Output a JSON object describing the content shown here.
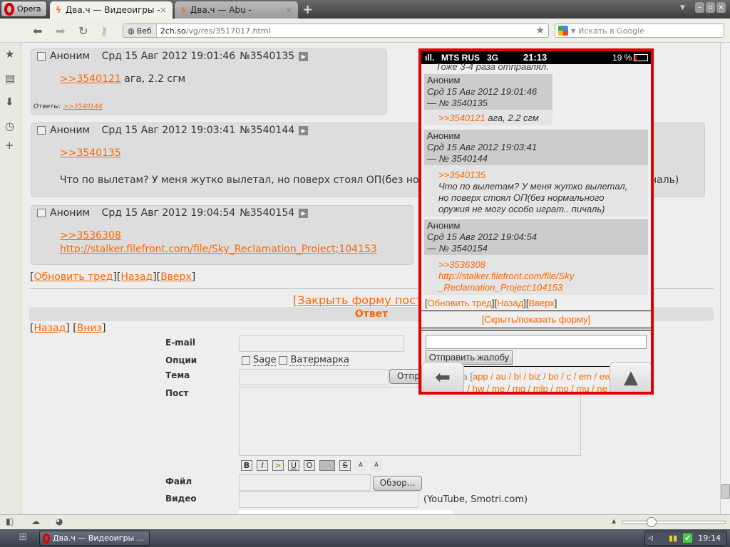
{
  "browser": {
    "opera_label": "Opera",
    "tabs": [
      {
        "title": "Два.ч — Видеоигры -",
        "active": true
      },
      {
        "title": "Два.ч — Abu -",
        "active": false
      }
    ],
    "new_tab": "+",
    "address_prefix": "Веб",
    "url_host": "2ch.so",
    "url_path": "/vg/res/3517017.html",
    "search_placeholder": "Искать в Google"
  },
  "posts": [
    {
      "author": "Аноним",
      "date": "Срд 15 Авг 2012 19:01:46",
      "num": "№3540135",
      "ref": ">>3540121",
      "text": "ага, 2.2 сгм",
      "replies_label": "Ответы:",
      "replies": ">>3540144"
    },
    {
      "author": "Аноним",
      "date": "Срд 15 Авг 2012 19:03:41",
      "num": "№3540144",
      "ref": ">>3540135",
      "text": "Что по вылетам? У меня жутко вылетал, но поверх стоял ОП(без нормального оружия не могу особо играт.. пичаль)"
    },
    {
      "author": "Аноним",
      "date": "Срд 15 Авг 2012 19:04:54",
      "num": "№3540154",
      "ref": ">>3536308",
      "link": "http://stalker.filefront.com/file/Sky_Reclamation_Project;104153"
    }
  ],
  "thread_nav": {
    "refresh": "Обновить тред",
    "back": "Назад",
    "up": "Вверх"
  },
  "form": {
    "close_form": "[Закрыть форму пост",
    "reply_title": "Ответ",
    "back": "Назад",
    "down": "Вниз",
    "email_label": "E-mail",
    "options_label": "Опции",
    "sage": "Sage",
    "watermark": "Ватермарка",
    "subject_label": "Тема",
    "submit": "Отпр",
    "post_label": "Пост",
    "file_label": "Файл",
    "browse": "Обзор...",
    "video_label": "Видео",
    "video_hint": "(YouTube, Smotri.com)",
    "format_buttons": [
      "B",
      "I",
      ">",
      "U",
      "O",
      "",
      "S",
      "A",
      "A"
    ]
  },
  "phone": {
    "carrier": "MTS RUS",
    "network": "3G",
    "time": "21:13",
    "battery": "19 %",
    "prev_text": "Тоже 3-4 раза отправлял.",
    "posts": [
      {
        "author": "Аноним",
        "date": "Срд 15 Авг 2012 19:01:46",
        "num": "— № 3540135",
        "ref": ">>3540121",
        "text": "ага, 2.2 сгм"
      },
      {
        "author": "Аноним",
        "date": "Срд 15 Авг 2012 19:03:41",
        "num": "— № 3540144",
        "ref": ">>3540135",
        "text": "Что по вылетам? У меня жутко вылетал, но поверх стоял ОП(без нормального оружия не могу особо играт.. пичаль)"
      },
      {
        "author": "Аноним",
        "date": "Срд 15 Авг 2012 19:04:54",
        "num": "— № 3540154",
        "ref": ">>3536308",
        "link": "http://stalker.filefront.com/file/Sky_Reclamation_Project;104153"
      }
    ],
    "refresh": "Обновить тред",
    "back": "Назад",
    "up": "Вверх",
    "toggle_form": "[Скрыть/показать форму]",
    "complaint_button": "Отправить жалобу",
    "boards_label": "Тематика [",
    "boards1": "app / au / bi / biz / bo / c / em / ew / fa /",
    "boards2": "fl / gd / hi / hw / me / mg / mlp / mo / mu / ne /"
  },
  "taskbar": {
    "task": "Два.ч — Видеоигры ...",
    "clock": "19:14"
  },
  "colors": {
    "accent": "#ff6600",
    "frame": "#e00000"
  }
}
